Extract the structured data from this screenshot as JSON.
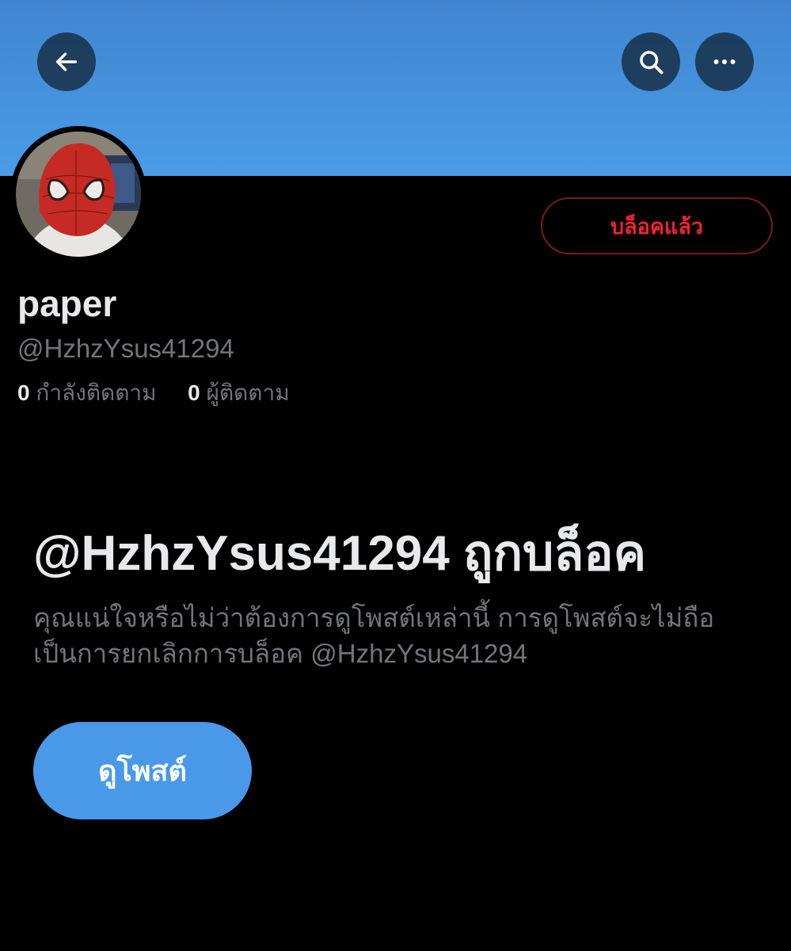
{
  "header": {
    "back_icon": "arrow-left-icon",
    "search_icon": "search-icon",
    "more_icon": "more-horizontal-icon",
    "banner_color": "#4b9be6"
  },
  "profile": {
    "avatar": "spider-man-mask-avatar",
    "display_name": "paper",
    "handle": "@HzhzYsus41294",
    "blocked_button_label": "บล็อคแล้ว",
    "following_count": "0",
    "following_label": "กำลังติดตาม",
    "followers_count": "0",
    "followers_label": "ผู้ติดตาม"
  },
  "blocked_notice": {
    "title": "@HzhzYsus41294 ถูกบล็อค",
    "description": "คุณแน่ใจหรือไม่ว่าต้องการดูโพสต์เหล่านี้ การดูโพสต์จะไม่ถือเป็นการยกเลิกการบล็อค @HzhzYsus41294",
    "view_posts_label": "ดูโพสต์"
  },
  "colors": {
    "accent_blue": "#4a99e9",
    "blocked_red": "#f4212e",
    "background": "#000000"
  }
}
